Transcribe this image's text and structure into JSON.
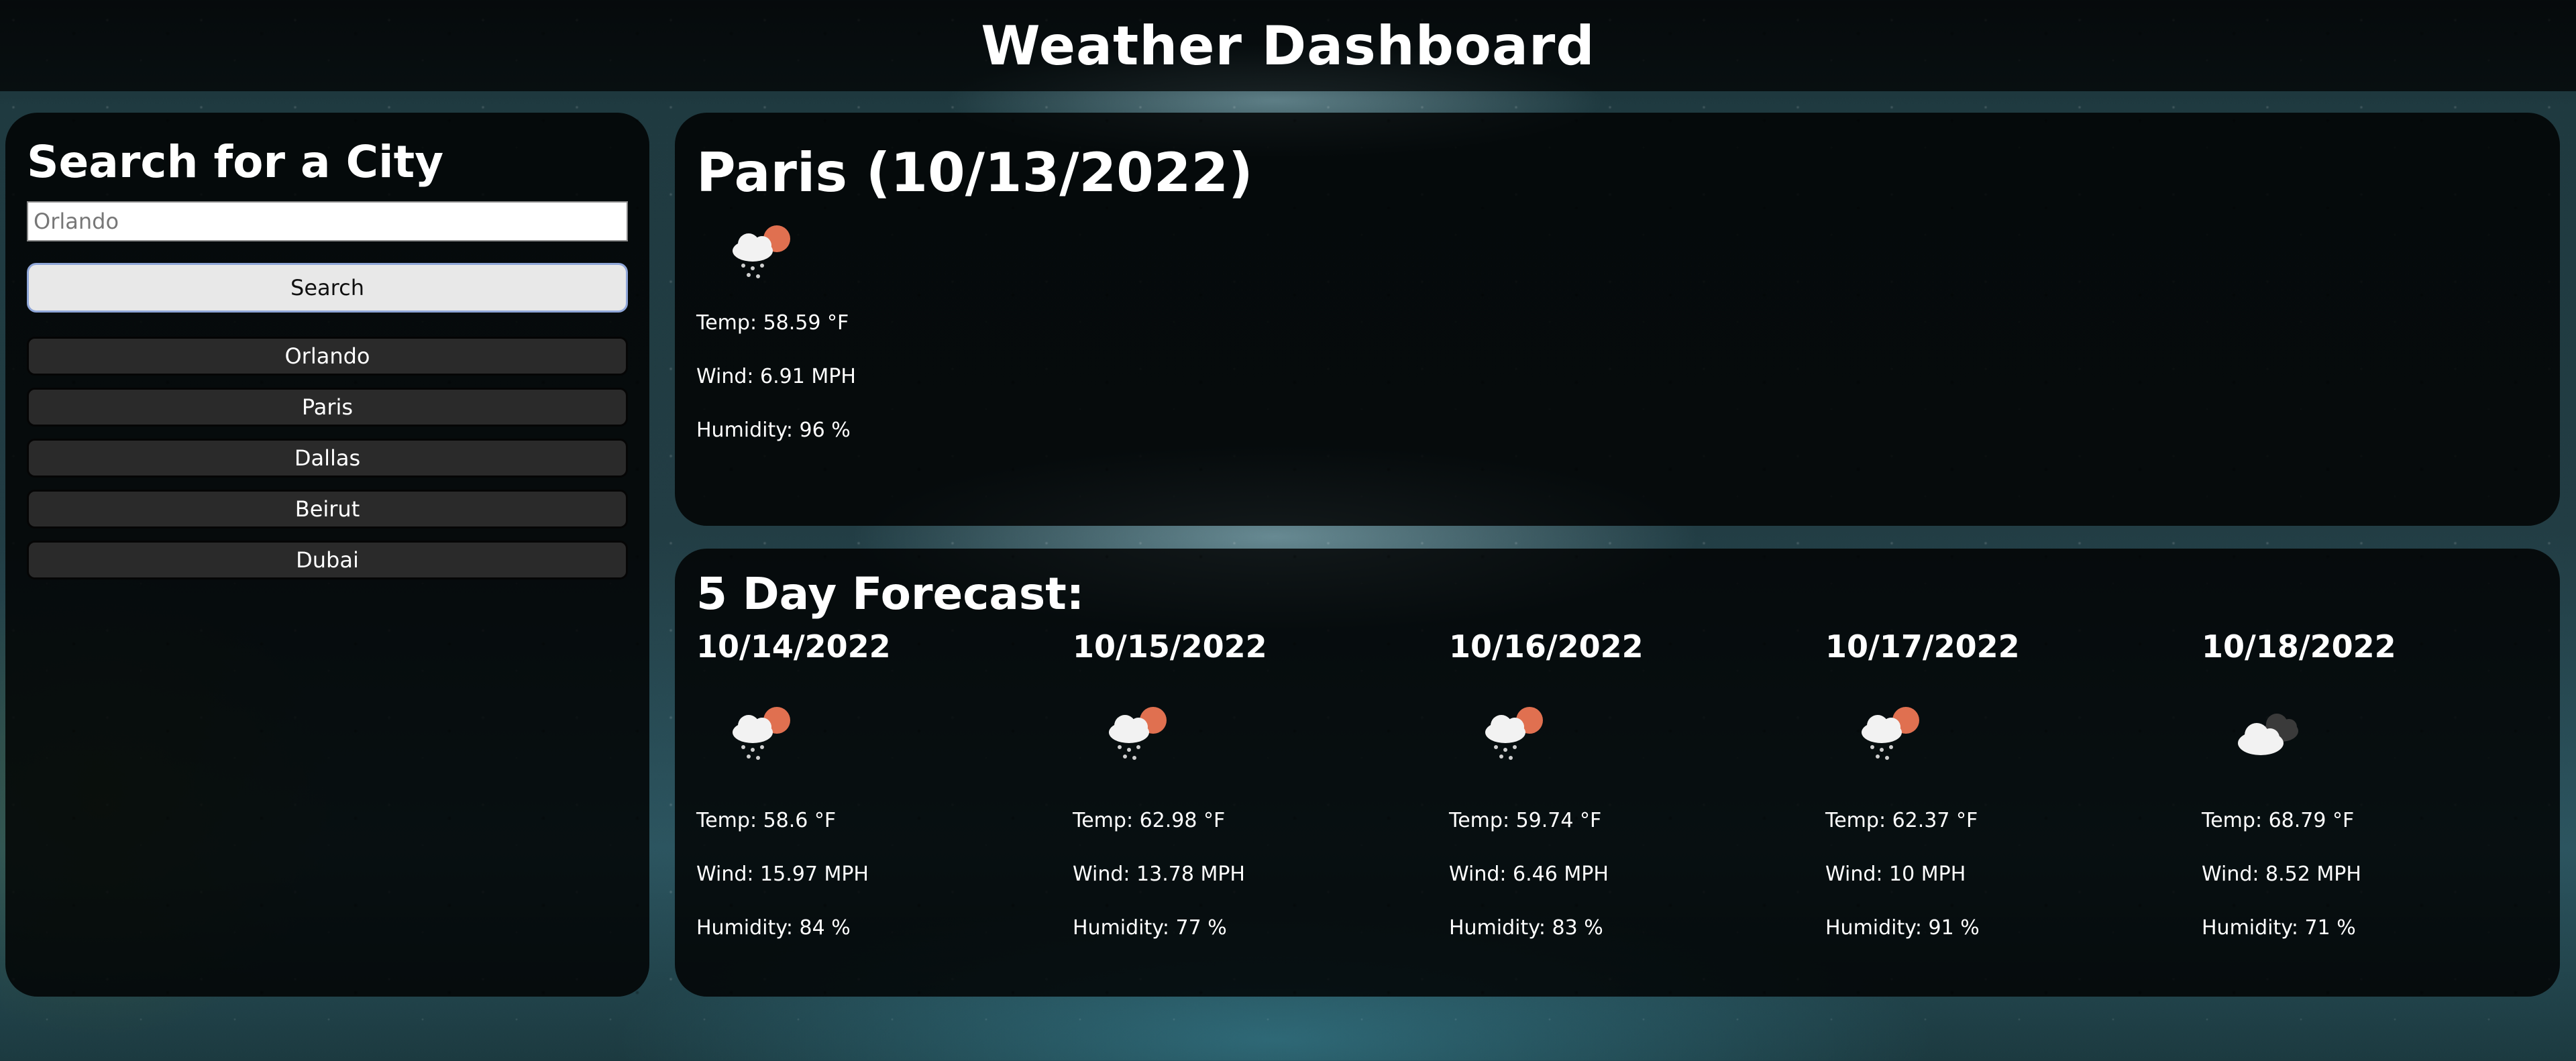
{
  "header": {
    "title": "Weather Dashboard"
  },
  "search": {
    "heading": "Search for a City",
    "placeholder": "Orlando",
    "button_label": "Search"
  },
  "history": [
    "Orlando",
    "Paris",
    "Dallas",
    "Beirut",
    "Dubai"
  ],
  "current": {
    "title": "Paris (10/13/2022)",
    "icon": "rain-cloud-sun-icon",
    "temp": "Temp: 58.59 °F",
    "wind": "Wind: 6.91 MPH",
    "humidity": "Humidity: 96 %"
  },
  "forecast": {
    "heading": "5 Day Forecast:",
    "days": [
      {
        "date": "10/14/2022",
        "icon": "rain-cloud-sun-icon",
        "temp": "Temp: 58.6 °F",
        "wind": "Wind: 15.97 MPH",
        "humidity": "Humidity: 84 %"
      },
      {
        "date": "10/15/2022",
        "icon": "rain-cloud-sun-icon",
        "temp": "Temp: 62.98 °F",
        "wind": "Wind: 13.78 MPH",
        "humidity": "Humidity: 77 %"
      },
      {
        "date": "10/16/2022",
        "icon": "rain-cloud-sun-icon",
        "temp": "Temp: 59.74 °F",
        "wind": "Wind: 6.46 MPH",
        "humidity": "Humidity: 83 %"
      },
      {
        "date": "10/17/2022",
        "icon": "rain-cloud-sun-icon",
        "temp": "Temp: 62.37 °F",
        "wind": "Wind: 10 MPH",
        "humidity": "Humidity: 91 %"
      },
      {
        "date": "10/18/2022",
        "icon": "broken-clouds-icon",
        "temp": "Temp: 68.79 °F",
        "wind": "Wind: 8.52 MPH",
        "humidity": "Humidity: 71 %"
      }
    ]
  },
  "colors": {
    "panel": "#000000",
    "sun": "#e07050",
    "cloud": "#f2f2f2",
    "dark_cloud": "#3a3a3a"
  }
}
